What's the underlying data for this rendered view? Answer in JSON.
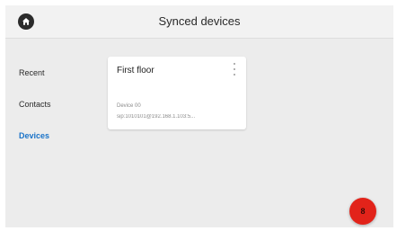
{
  "header": {
    "title": "Synced devices",
    "home_icon": "home-icon"
  },
  "sidebar": {
    "items": [
      {
        "label": "Recent",
        "active": false
      },
      {
        "label": "Contacts",
        "active": false
      },
      {
        "label": "Devices",
        "active": true
      }
    ]
  },
  "devices": [
    {
      "name": "First floor",
      "label": "Device 00",
      "address": "sip:1010101@192.168.1.103:5..."
    }
  ],
  "fab": {
    "label": "8",
    "icon": "fab-icon"
  },
  "colors": {
    "accent": "#1a73c8",
    "fab": "#e2231a",
    "background": "#ececec"
  }
}
